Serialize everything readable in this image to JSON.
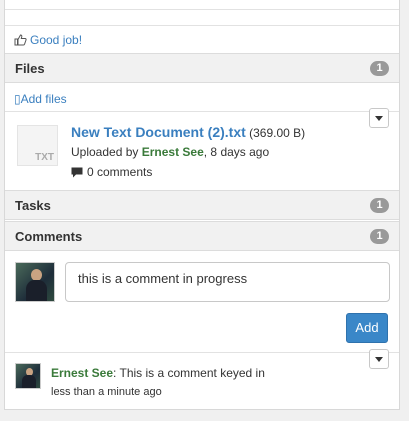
{
  "reaction": {
    "label": "Good job!",
    "icon": "thumbs-up-icon"
  },
  "files": {
    "title": "Files",
    "count": "1",
    "add_label": "Add files",
    "items": [
      {
        "name": "New Text Document (2).txt",
        "size": "(369.00 B)",
        "thumb_label": "TXT",
        "uploaded_prefix": "Uploaded by ",
        "uploader": "Ernest See",
        "uploaded_suffix": ", 8 days ago",
        "comments": "0 comments"
      }
    ]
  },
  "tasks": {
    "title": "Tasks",
    "count": "1"
  },
  "comments": {
    "title": "Comments",
    "count": "1",
    "input_value": "this is a comment in progress",
    "add_button": "Add",
    "items": [
      {
        "user": "Ernest See",
        "separator": ": ",
        "text": "This is a comment keyed in",
        "time": "less than a minute ago"
      }
    ]
  },
  "colors": {
    "link": "#3a7fbf",
    "user": "#3a7a3a",
    "badge": "#999999",
    "primary_button": "#3a87c8"
  }
}
